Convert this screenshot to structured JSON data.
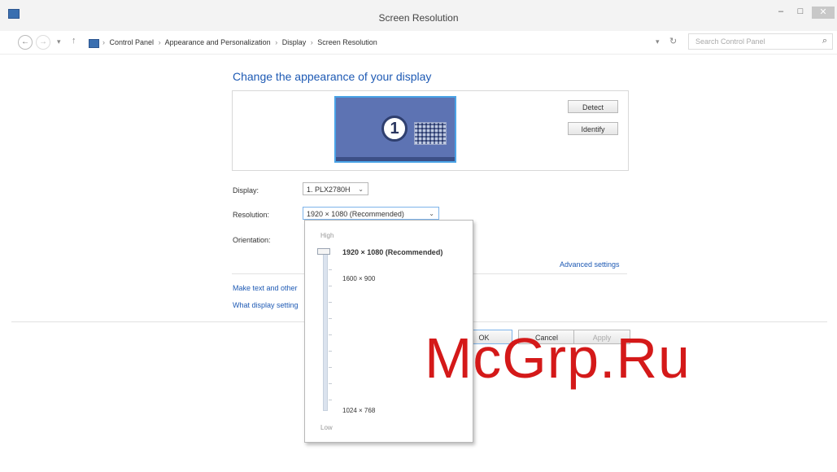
{
  "window": {
    "title": "Screen Resolution",
    "min_glyph": "–",
    "max_glyph": "□",
    "close_glyph": "✕"
  },
  "nav": {
    "back_glyph": "←",
    "forward_glyph": "→",
    "recent_glyph": "▾",
    "up_glyph": "↑",
    "breadcrumb": [
      "Control Panel",
      "Appearance and Personalization",
      "Display",
      "Screen Resolution"
    ],
    "separator": "›",
    "dropdown_glyph": "▾",
    "refresh_glyph": "↻",
    "search_placeholder": "Search Control Panel",
    "search_glyph": "⌕"
  },
  "main": {
    "heading": "Change the appearance of your display",
    "monitor_number": "1",
    "detect_label": "Detect",
    "identify_label": "Identify",
    "display_label": "Display:",
    "display_value": "1. PLX2780H",
    "resolution_label": "Resolution:",
    "resolution_value": "1920 × 1080 (Recommended)",
    "orientation_label": "Orientation:",
    "advanced_link": "Advanced settings",
    "link_text_size": "Make text and other",
    "link_display_settings": "What display setting",
    "ok_label": "OK",
    "cancel_label": "Cancel",
    "apply_label": "Apply"
  },
  "resolution_popup": {
    "high_label": "High",
    "low_label": "Low",
    "options": [
      "1920 × 1080 (Recommended)",
      "1600 × 900",
      "1024 × 768"
    ],
    "selected_index": 0
  },
  "watermark": "McGrp.Ru"
}
